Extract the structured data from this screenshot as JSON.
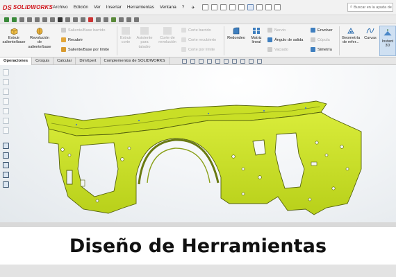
{
  "app": {
    "brand": "SOLIDWORKS",
    "brand_mark": "DS"
  },
  "menu": [
    "Archivo",
    "Edición",
    "Ver",
    "Insertar",
    "Herramientas",
    "Ventana",
    "?"
  ],
  "search": {
    "placeholder": "Buscar en la ayuda de"
  },
  "ribbon": {
    "extrude": "Extruir saliente/base",
    "revolve": "Revolución de saliente/base",
    "sweep_boss": "Saliente/Base barrido",
    "recubrir": "Recubrir",
    "boundary_boss": "Saliente/Base por límite",
    "extrude_cut": "Extruir corte",
    "hole_wizard": "Asistente para taladro",
    "revolve_cut": "Corte de revolución",
    "sweep_cut": "Corte barrido",
    "loft_cut": "Corte recubierto",
    "boundary_cut": "Corte por límite",
    "fillet": "Redondeo",
    "linear_pattern": "Matriz lineal",
    "rib": "Nervio",
    "draft": "Ángulo de salida",
    "shell": "Vaciado",
    "wrap": "Envolver",
    "intersect": "Cúpula",
    "mirror": "Simetría",
    "ref_geom": "Geometría de refer...",
    "curves": "Curvas",
    "instant3d": "Instant 3D"
  },
  "tabs": [
    "Operaciones",
    "Croquis",
    "Calcular",
    "DimXpert",
    "Complementos de SOLIDWORKS"
  ],
  "caption": "Diseño de Herramientas",
  "colors": {
    "part": "#c8e021",
    "part_edge": "#5c6a12",
    "brand": "#d0141b"
  }
}
